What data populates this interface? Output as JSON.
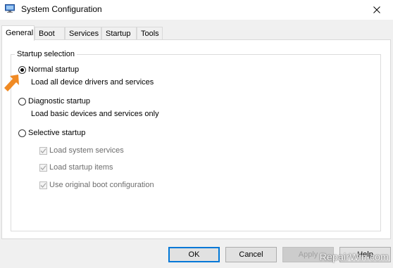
{
  "window": {
    "title": "System Configuration",
    "icon": "system-config-icon",
    "close_icon": "close-icon"
  },
  "tabs": [
    {
      "label": "General",
      "active": true
    },
    {
      "label": "Boot",
      "active": false
    },
    {
      "label": "Services",
      "active": false
    },
    {
      "label": "Startup",
      "active": false
    },
    {
      "label": "Tools",
      "active": false
    }
  ],
  "startup_selection": {
    "group_label": "Startup selection",
    "normal": {
      "label": "Normal startup",
      "description": "Load all device drivers and services",
      "selected": true
    },
    "diagnostic": {
      "label": "Diagnostic startup",
      "description": "Load basic devices and services only",
      "selected": false
    },
    "selective": {
      "label": "Selective startup",
      "selected": false,
      "options": [
        {
          "label": "Load system services",
          "checked": true,
          "enabled": false
        },
        {
          "label": "Load startup items",
          "checked": true,
          "enabled": false
        },
        {
          "label": "Use original boot configuration",
          "checked": true,
          "enabled": false
        }
      ]
    }
  },
  "buttons": {
    "ok": "OK",
    "cancel": "Cancel",
    "apply": "Apply",
    "help": "Help"
  },
  "watermark": "RepairWin.com",
  "colors": {
    "accent": "#0078d7",
    "arrow": "#f08a24"
  }
}
